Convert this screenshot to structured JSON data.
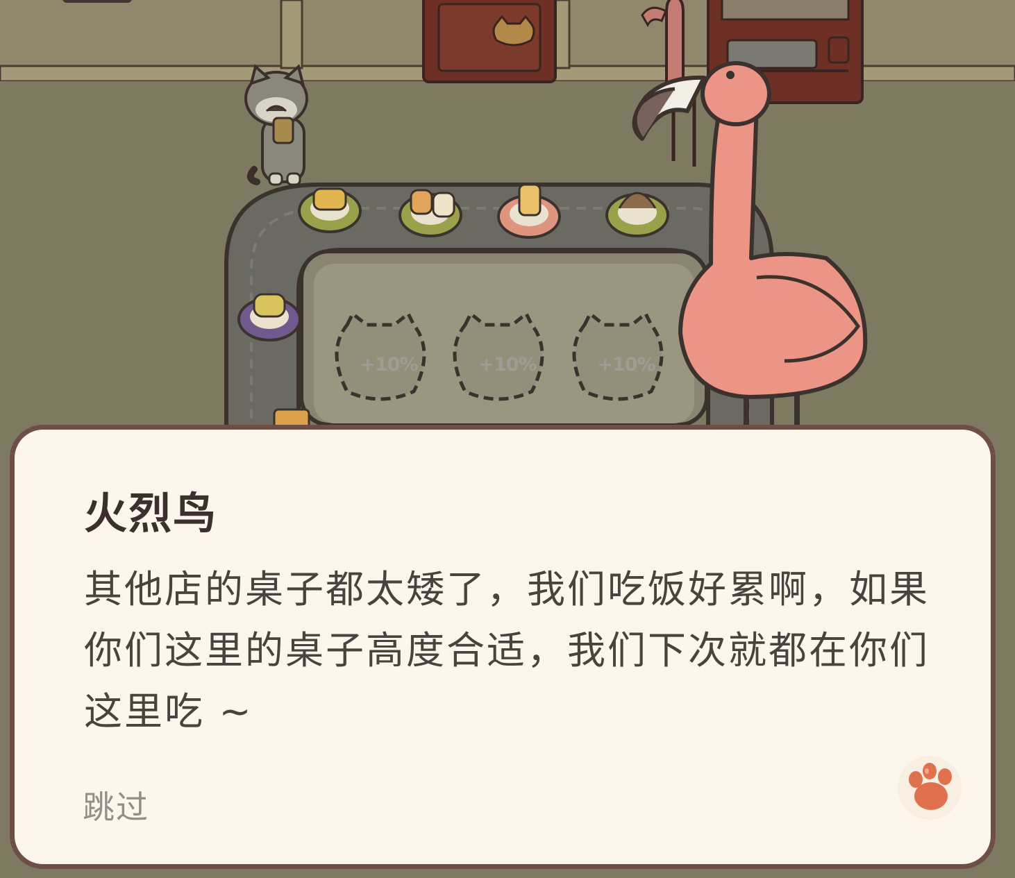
{
  "scene": {
    "conveyor_slots": [
      {
        "bonus_label": "+10%"
      },
      {
        "bonus_label": "+10%"
      },
      {
        "bonus_label": "+10%"
      }
    ],
    "characters": [
      "cat-chef",
      "flamingo-customer",
      "flamingo-background"
    ],
    "colors": {
      "floor": "#7e7a61",
      "wall": "#8f886c",
      "conveyor": "#6a6a63",
      "flamingo": "#ec9486"
    }
  },
  "dialog": {
    "speaker": "火烈鸟",
    "text": "其他店的桌子都太矮了，我们吃饭好累啊，如果你们这里的桌子高度合适，我们下次就都在你们这里吃 ~",
    "skip_label": "跳过",
    "next_icon": "paw-icon",
    "colors": {
      "panel_bg": "#fdf6ec",
      "panel_border": "#6e4f47",
      "paw": "#e0714f"
    }
  }
}
